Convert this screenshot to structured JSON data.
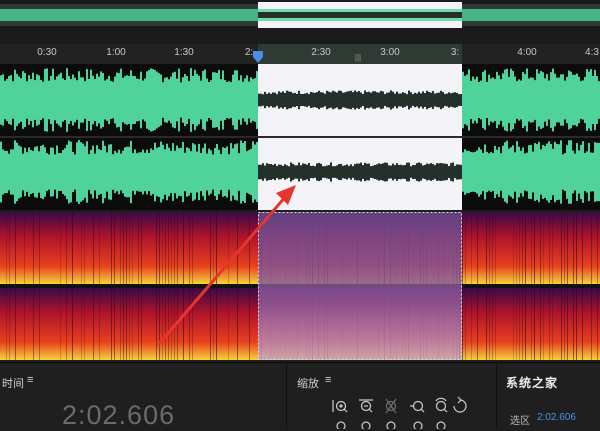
{
  "ruler": {
    "ticks": [
      "0:30",
      "1:00",
      "1:30",
      "2:",
      "2:30",
      "3:00",
      "3:",
      "4:00",
      "4:3"
    ],
    "playhead_glyph": "|||"
  },
  "bottom": {
    "time_panel_title": "时间",
    "time_value": "2:02.606",
    "zoom_panel_title": "缩放",
    "selection_label": "选区",
    "selection_value": "2:02.606",
    "watermark_text": "系统之家"
  },
  "colors": {
    "waveform_green": "#4fd39a",
    "selection_bg": "#f4f4f8",
    "selection_wave": "#24302a",
    "spectral_base": "#7a0b30",
    "accent_blue": "#4a90e2",
    "arrow_red": "#e8352b"
  },
  "icons": [
    "zoom-in-amplitude-icon",
    "zoom-out-amplitude-icon",
    "zoom-in-time-icon",
    "zoom-out-time-icon",
    "zoom-reset-icon",
    "zoom-selection-icon",
    "zoom-full-icon"
  ]
}
